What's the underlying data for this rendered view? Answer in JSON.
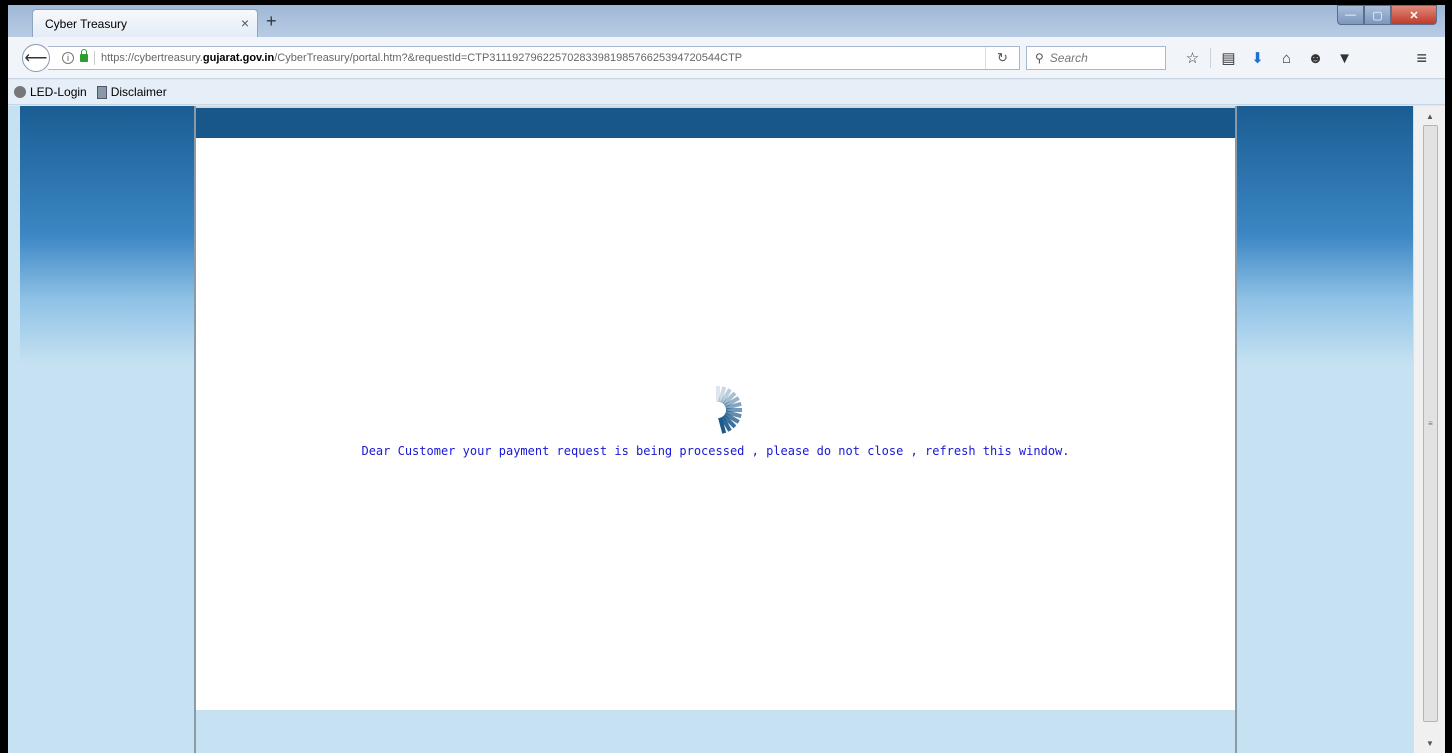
{
  "browser": {
    "tab_title": "Cyber Treasury",
    "tab_close": "×",
    "new_tab": "+",
    "window_buttons": {
      "minimize": "—",
      "maximize": "▢",
      "close": "✕"
    },
    "back": "⟵",
    "url_info": "i",
    "url_prefix": "https://cybertreasury.",
    "url_domain": "gujarat.gov.in",
    "url_path": "/CyberTreasury/portal.htm?&requestId=CTP311192796225702833981985766253947205​44CTP",
    "reload": "↻",
    "search_placeholder": "Search",
    "search_icon": "⚲",
    "toolbar_icons": [
      {
        "name": "bookmark-star-icon",
        "glyph": "☆"
      },
      {
        "name": "reading-list-icon",
        "glyph": "▤"
      },
      {
        "name": "download-icon",
        "glyph": "⬇"
      },
      {
        "name": "home-icon",
        "glyph": "⌂"
      },
      {
        "name": "chat-icon",
        "glyph": "☻"
      },
      {
        "name": "pocket-icon",
        "glyph": "▼"
      }
    ],
    "menu": "≡",
    "bookmarks": [
      {
        "label": "LED-Login",
        "icon": "globe-icon"
      },
      {
        "label": "Disclaimer",
        "icon": "page-icon"
      }
    ]
  },
  "page": {
    "message": "Dear Customer your payment request is being processed , please do not close , refresh this window."
  },
  "scrollbar": {
    "up": "▲",
    "down": "▼",
    "grip": "≡"
  },
  "colors": {
    "header_blue": "#17578a",
    "message_blue": "#1818d8",
    "light_blue": "#c6e2f2"
  }
}
